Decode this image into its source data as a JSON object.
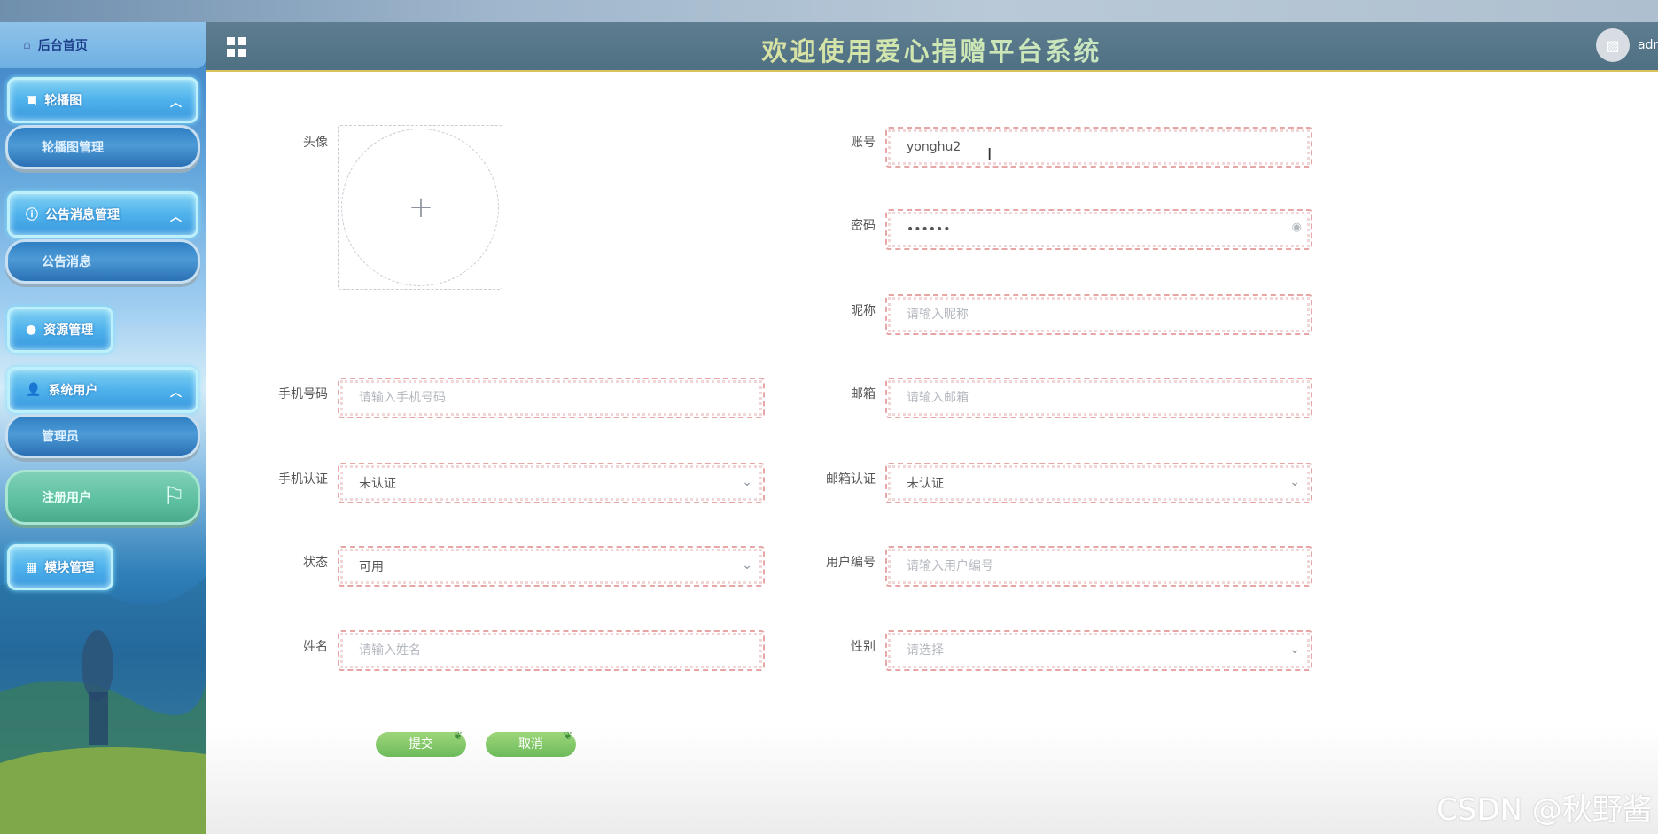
{
  "header": {
    "title": "欢迎使用爱心捐赠平台系统",
    "user": "adm"
  },
  "sidebar": {
    "home": "后台首页",
    "groups": [
      {
        "label": "轮播图",
        "sub": [
          "轮播图管理"
        ]
      },
      {
        "label": "公告消息管理",
        "sub": [
          "公告消息"
        ]
      },
      {
        "label": "资源管理",
        "sub": []
      },
      {
        "label": "系统用户",
        "sub": [
          "管理员",
          "注册用户"
        ]
      },
      {
        "label": "模块管理",
        "sub": []
      }
    ]
  },
  "form": {
    "avatar_label": "头像",
    "account": {
      "label": "账号",
      "value": "yonghu2"
    },
    "password": {
      "label": "密码",
      "value": "••••••"
    },
    "nickname": {
      "label": "昵称",
      "placeholder": "请输入昵称"
    },
    "phone": {
      "label": "手机号码",
      "placeholder": "请输入手机号码"
    },
    "email": {
      "label": "邮箱",
      "placeholder": "请输入邮箱"
    },
    "phone_verify": {
      "label": "手机认证",
      "value": "未认证"
    },
    "email_verify": {
      "label": "邮箱认证",
      "value": "未认证"
    },
    "status": {
      "label": "状态",
      "value": "可用"
    },
    "user_no": {
      "label": "用户编号",
      "placeholder": "请输入用户编号"
    },
    "name": {
      "label": "姓名",
      "placeholder": "请输入姓名"
    },
    "gender": {
      "label": "性别",
      "placeholder": "请选择"
    },
    "submit": "提交",
    "cancel": "取消"
  },
  "watermark": "CSDN @秋野酱"
}
